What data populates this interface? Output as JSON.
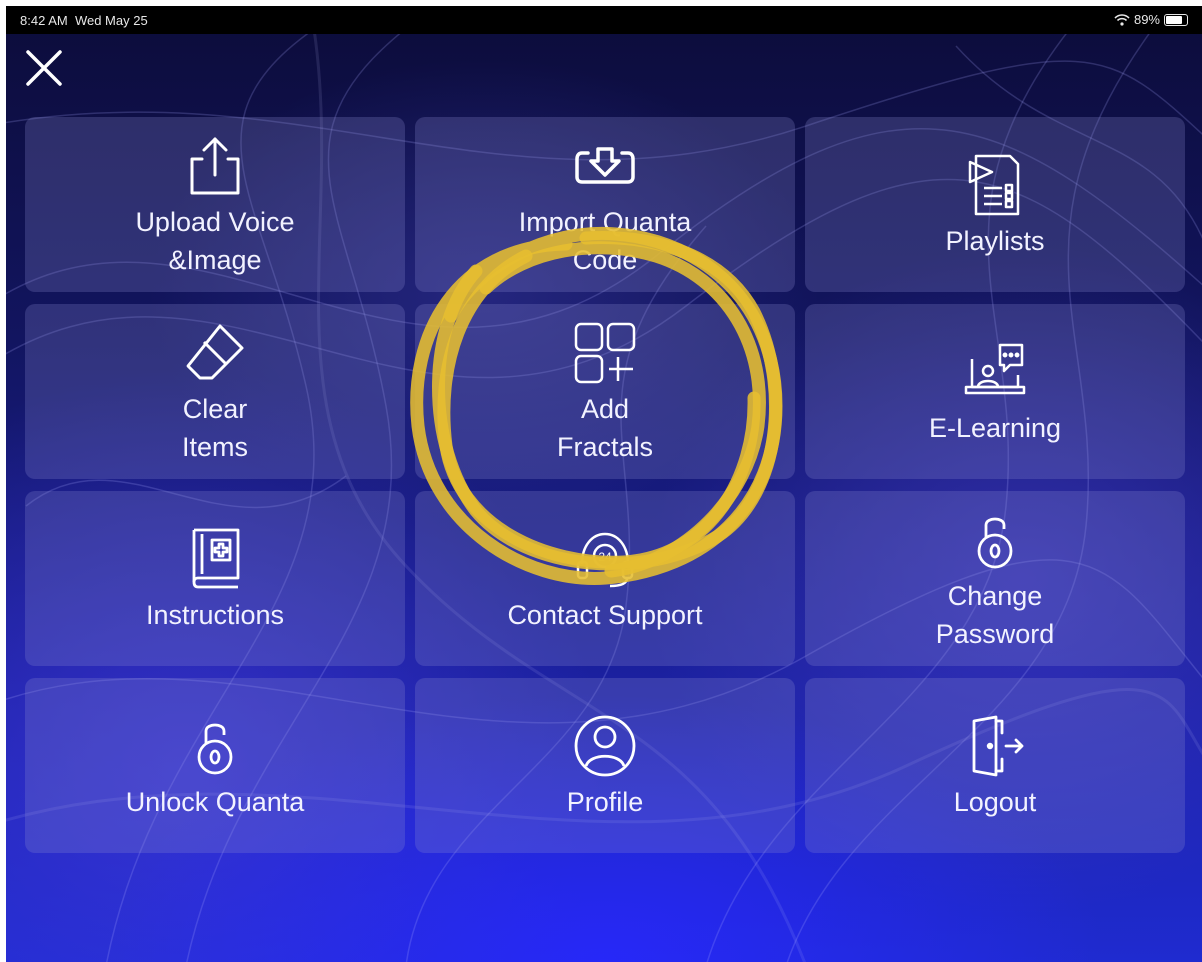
{
  "status_bar": {
    "time": "8:42 AM",
    "date": "Wed May 25",
    "battery": "89%",
    "battery_level": 0.89
  },
  "menu": {
    "close_icon": "close-icon",
    "tiles": [
      {
        "id": "upload",
        "label_line1": "Upload Voice",
        "label_line2": "&Image",
        "icon": "upload-icon"
      },
      {
        "id": "import",
        "label_line1": "Import Quanta",
        "label_line2": "Code",
        "icon": "download-icon"
      },
      {
        "id": "playlists",
        "label_line1": "Playlists",
        "label_line2": "",
        "icon": "playlist-icon"
      },
      {
        "id": "clear",
        "label_line1": "Clear",
        "label_line2": "Items",
        "icon": "eraser-icon"
      },
      {
        "id": "fractals",
        "label_line1": "Add",
        "label_line2": "Fractals",
        "icon": "add-grid-icon"
      },
      {
        "id": "elearning",
        "label_line1": "E-Learning",
        "label_line2": "",
        "icon": "elearning-icon"
      },
      {
        "id": "instructions",
        "label_line1": "Instructions",
        "label_line2": "",
        "icon": "medical-book-icon"
      },
      {
        "id": "support",
        "label_line1": "Contact Support",
        "label_line2": "",
        "icon": "headset-24-icon"
      },
      {
        "id": "password",
        "label_line1": "Change",
        "label_line2": "Password",
        "icon": "padlock-icon"
      },
      {
        "id": "unlock",
        "label_line1": "Unlock Quanta",
        "label_line2": "",
        "icon": "padlock-icon"
      },
      {
        "id": "profile",
        "label_line1": "Profile",
        "label_line2": "",
        "icon": "user-circle-icon"
      },
      {
        "id": "logout",
        "label_line1": "Logout",
        "label_line2": "",
        "icon": "logout-door-icon"
      }
    ]
  },
  "colors": {
    "tile_background": "#8c8cd2",
    "text": "#f2f2ff",
    "highlight_scribble": "#e8c23a"
  }
}
